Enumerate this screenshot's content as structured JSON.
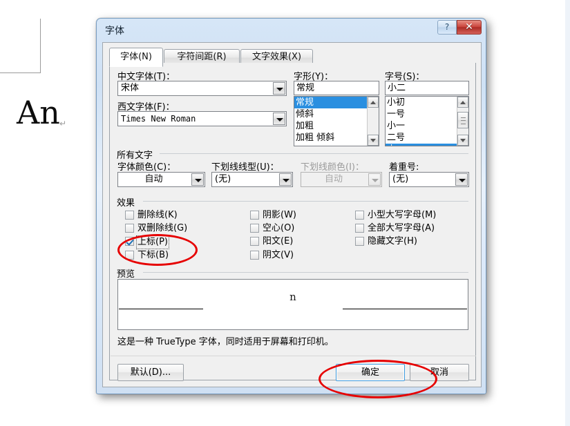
{
  "document": {
    "text": "An",
    "paragraph_mark": "↵"
  },
  "dialog": {
    "title": "字体",
    "help_button": "?",
    "close_button": "✕",
    "tabs": [
      {
        "label": "字体(N)",
        "active": true
      },
      {
        "label": "字符间距(R)",
        "active": false
      },
      {
        "label": "文字效果(X)",
        "active": false
      }
    ],
    "font_section": {
      "chinese_font_label": "中文字体(T)：",
      "chinese_font_value": "宋体",
      "western_font_label": "西文字体(F)：",
      "western_font_value": "Times New Roman",
      "style_label": "字形(Y)：",
      "style_value": "常规",
      "style_options": [
        "常规",
        "倾斜",
        "加粗",
        "加粗  倾斜"
      ],
      "style_selected_index": 0,
      "size_label": "字号(S)：",
      "size_value": "小二",
      "size_options": [
        "小初",
        "一号",
        "小一",
        "二号",
        "小二"
      ],
      "size_selected_index": 4
    },
    "all_text_section": {
      "group_label": "所有文字",
      "font_color_label": "字体颜色(C)：",
      "font_color_value": "自动",
      "underline_style_label": "下划线线型(U)：",
      "underline_style_value": "(无)",
      "underline_color_label": "下划线颜色(I)：",
      "underline_color_value": "自动",
      "underline_color_disabled": true,
      "emphasis_label": "着重号:",
      "emphasis_value": "(无)"
    },
    "effects_section": {
      "group_label": "效果",
      "column1": [
        {
          "label": "删除线(K)",
          "checked": false
        },
        {
          "label": "双删除线(G)",
          "checked": false
        },
        {
          "label": "上标(P)",
          "checked": true
        },
        {
          "label": "下标(B)",
          "checked": false
        }
      ],
      "column2": [
        {
          "label": "阴影(W)",
          "checked": false
        },
        {
          "label": "空心(O)",
          "checked": false
        },
        {
          "label": "阳文(E)",
          "checked": false
        },
        {
          "label": "阴文(V)",
          "checked": false
        }
      ],
      "column3": [
        {
          "label": "小型大写字母(M)",
          "checked": false
        },
        {
          "label": "全部大写字母(A)",
          "checked": false
        },
        {
          "label": "隐藏文字(H)",
          "checked": false
        }
      ]
    },
    "preview_section": {
      "group_label": "预览",
      "preview_text": "n",
      "note": "这是一种 TrueType 字体，同时适用于屏幕和打印机。"
    },
    "buttons": {
      "default_label": "默认(D)...",
      "ok_label": "确定",
      "cancel_label": "取消"
    }
  },
  "annotations": {
    "accent_color": "#e60000",
    "superscript_highlight": "上标(P)",
    "ok_highlight": "确定"
  }
}
